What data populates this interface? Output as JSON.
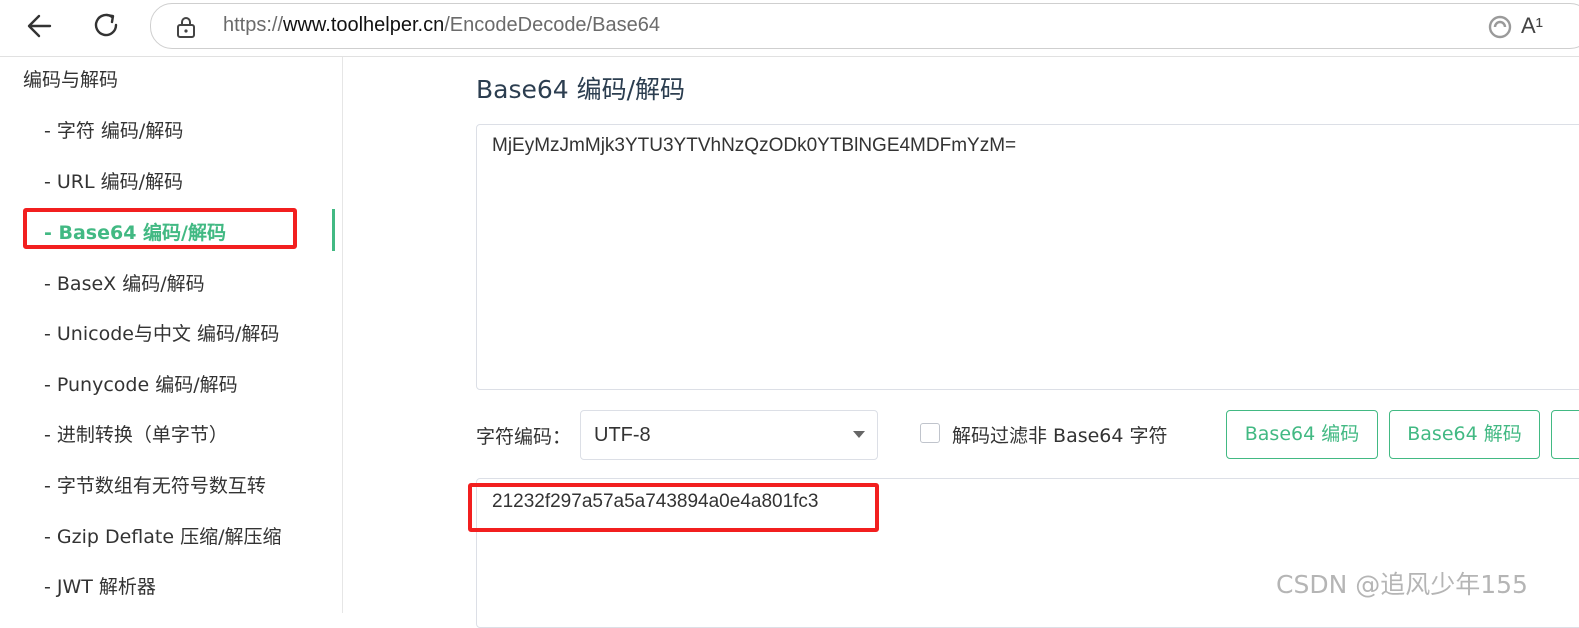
{
  "browser": {
    "url_prefix": "https://",
    "url_domain": "www.toolhelper.cn",
    "url_path": "/EncodeDecode/Base64",
    "read_aloud_label": "A¹"
  },
  "sidebar": {
    "heading": "编码与解码",
    "items": [
      {
        "label": "- 字符  编码/解码"
      },
      {
        "label": "- URL  编码/解码"
      },
      {
        "label": "- Base64  编码/解码"
      },
      {
        "label": "- BaseX  编码/解码"
      },
      {
        "label": "- Unicode与中文  编码/解码"
      },
      {
        "label": "- Punycode  编码/解码"
      },
      {
        "label": "- 进制转换（单字节）"
      },
      {
        "label": "- 字节数组有无符号数互转"
      },
      {
        "label": "- Gzip Deflate 压缩/解压缩"
      },
      {
        "label": "- JWT 解析器"
      }
    ],
    "active_index": 2
  },
  "main": {
    "title": "Base64 编码/解码",
    "input_value": "MjEyMzJmMjk3YTU3YTVhNzQzODk0YTBlNGE4MDFmYzM=",
    "encoding_label": "字符编码：",
    "encoding_value": "UTF-8",
    "filter_label": "解码过滤非 Base64 字符",
    "filter_checked": false,
    "encode_button": "Base64 编码",
    "decode_button": "Base64 解码",
    "output_value": "21232f297a57a5a743894a0e4a801fc3"
  },
  "colors": {
    "accent": "#42b983",
    "highlight": "#f21f1f"
  },
  "watermark": "CSDN @追风少年155"
}
